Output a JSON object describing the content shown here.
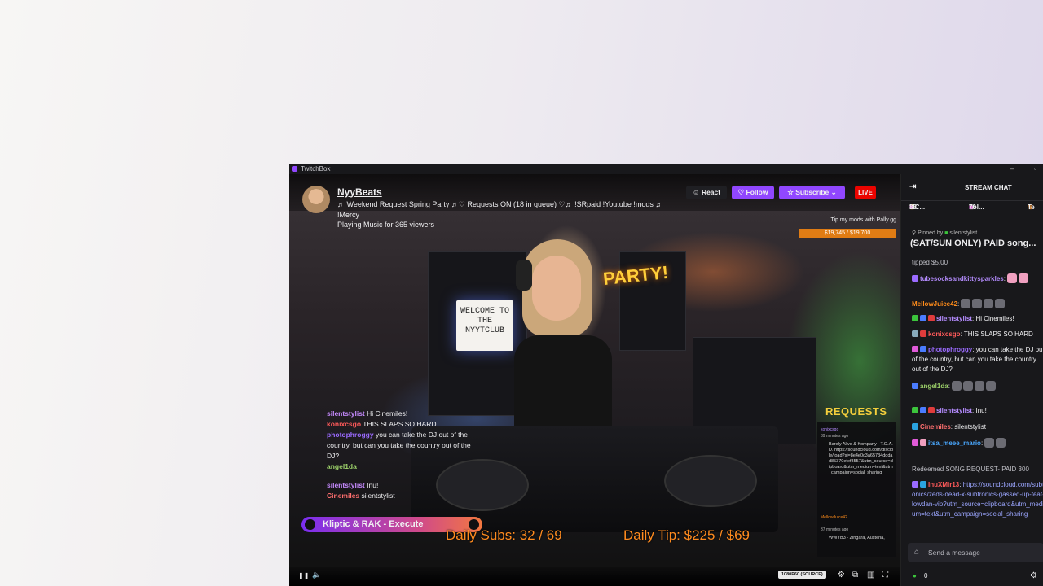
{
  "window": {
    "app_title": "TwitchBox",
    "minimize": "–",
    "maximize": "▫"
  },
  "stream": {
    "channel": "NyyBeats",
    "title": "♬ Weekend Request Spring Party ♬♡ Requests ON (18 in queue) ♡♬ !SRpaid !Youtube !mods ♬ !Mercy",
    "viewers": "Playing Music for 365 viewers",
    "live": "LIVE",
    "buttons": {
      "react": "React",
      "follow": "Follow",
      "subscribe": "Subscribe"
    }
  },
  "video": {
    "party_sign": "PARTY!",
    "lightbox": "WELCOME TO THE NYYTCLUB",
    "tip_label": "Tip my mods with Pally.gg",
    "tip_goal": "$19,745 / $19,700",
    "requests_label": "REQUESTS",
    "daily_subs": "Daily Subs: 32 / 69",
    "daily_tip": "Daily Tip: $225 / $69",
    "now_playing": "Kliptic & RAK - Execute",
    "overlay_chat": [
      {
        "user": "silentstylist",
        "text": "Hi Cinemiles!",
        "color": "#c78bff"
      },
      {
        "user": "konixcsgo",
        "text": "THIS SLAPS SO HARD",
        "color": "#ff5a5a"
      },
      {
        "user": "photophroggy",
        "text": "you can take the DJ out of the country, but can you take the country out of the DJ?",
        "color": "#9b6bff"
      },
      {
        "user": "angel1da",
        "text": "",
        "color": "#9dd26a"
      },
      {
        "user": "silentstylist",
        "text": "Inu!",
        "color": "#c78bff"
      },
      {
        "user": "Cinemiles",
        "text": "silentstylist",
        "color": "#ff6f6f"
      }
    ],
    "request_items": [
      {
        "user": "konixcsgo",
        "time": "39 minutes ago",
        "text": "Barely Alive & Kompany - T.O.A.D. https://soundcloud.com/disciple/toad?si=8e4e0c3a65734dddad85370efef3557&utm_source=clipboard&utm_medium=text&utm_campaign=social_sharing"
      },
      {
        "user": "MellowJuice42",
        "time": "37 minutes ago",
        "text": "WWYB3 - Zingara, Austeria,"
      }
    ]
  },
  "controls": {
    "play": "❚❚",
    "volume": "🔈",
    "quality": "1080P60 (SOURCE)",
    "settings": "⚙",
    "clip": "⧉",
    "theatre": "▥",
    "fullscreen": "⛶"
  },
  "chat": {
    "header": "STREAM CHAT",
    "collapse": "⇥",
    "leaderboard": [
      {
        "name": "MC...",
        "count": "88"
      },
      {
        "name": "hol...",
        "count": "70"
      },
      {
        "name": "Te",
        "count": ""
      }
    ],
    "pinned_by_label": "Pinned by",
    "pinned_by_user": "silentstylist",
    "pinned_text": "(SAT/SUN ONLY) PAID song...",
    "messages": [
      {
        "user": "",
        "text": "tipped $5.00",
        "color": "#bdbdc4"
      },
      {
        "user": "tubesocksandkittysparkles",
        "text": "",
        "color": "#b58cff"
      },
      {
        "user": "MellowJuice42",
        "text": "",
        "color": "#ff8c1a"
      },
      {
        "user": "silentstylist",
        "text": "Hi Cinemiles!",
        "color": "#b58cff"
      },
      {
        "user": "konixcsgo",
        "text": "THIS SLAPS SO HARD",
        "color": "#ff5a5a"
      },
      {
        "user": "photophroggy",
        "text": "you can take the DJ out of the country, but can you take the country out of the DJ?",
        "color": "#9b6bff"
      },
      {
        "user": "angel1da",
        "text": "",
        "color": "#9dd26a"
      },
      {
        "user": "silentstylist",
        "text": "Inu!",
        "color": "#b58cff"
      },
      {
        "user": "Cinemiles",
        "text": "silentstylist",
        "color": "#ff6f6f"
      },
      {
        "user": "itsa_meee_mario",
        "text": "",
        "color": "#4aa8ff"
      },
      {
        "user": "",
        "text": "Redeemed SONG REQUEST- PAID  300",
        "color": "#bdbdc4"
      },
      {
        "user": "InuXMir13",
        "text": "https://soundcloud.com/subtronics/zeds-dead-x-subtronics-gassed-up-feat-flowdan-vip?utm_source=clipboard&utm_medium=text&utm_campaign=social_sharing",
        "color": "#ff5a5a"
      }
    ],
    "input_placeholder": "Send a message",
    "points": "0"
  },
  "colors": {
    "accent": "#9147ff",
    "live": "#eb0400",
    "orange": "#ff8b1f"
  }
}
